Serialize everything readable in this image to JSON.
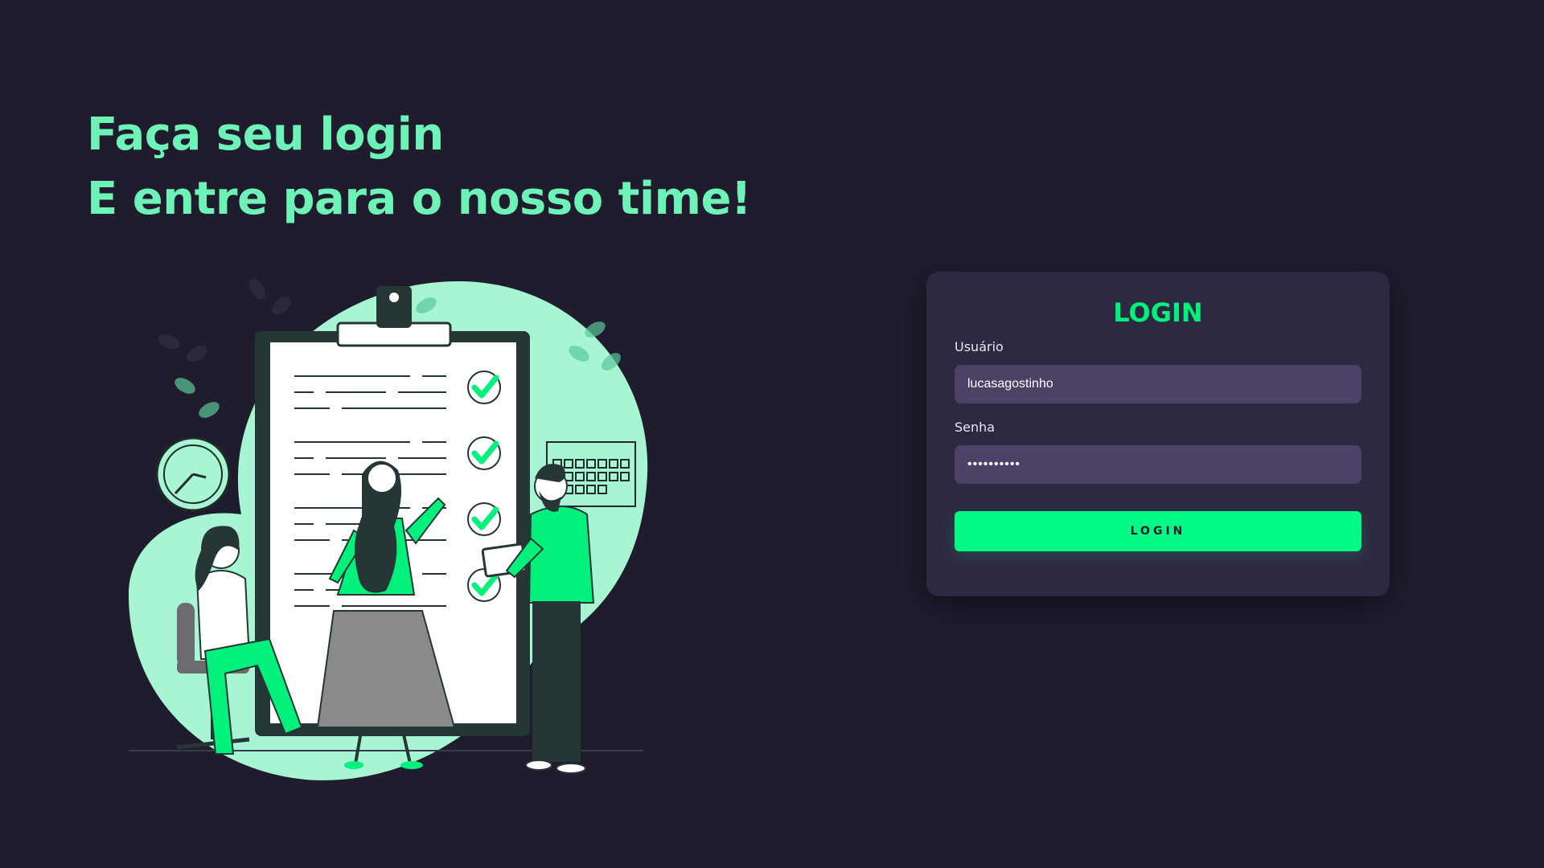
{
  "hero": {
    "line1": "Faça seu login",
    "line2": "E entre para o nosso time!"
  },
  "login_card": {
    "title": "LOGIN",
    "username_label": "Usuário",
    "username_value": "lucasagostinho",
    "password_label": "Senha",
    "password_value": "••••••••••",
    "button_label": "LOGIN"
  },
  "colors": {
    "background": "#1f1c2e",
    "accent": "#00fa85",
    "hero_text": "#6ef2b8",
    "card": "#2e2943",
    "input": "#4b4266",
    "blob": "#a8f5d4"
  },
  "icons": {
    "illustration": "team-checklist-illustration"
  }
}
